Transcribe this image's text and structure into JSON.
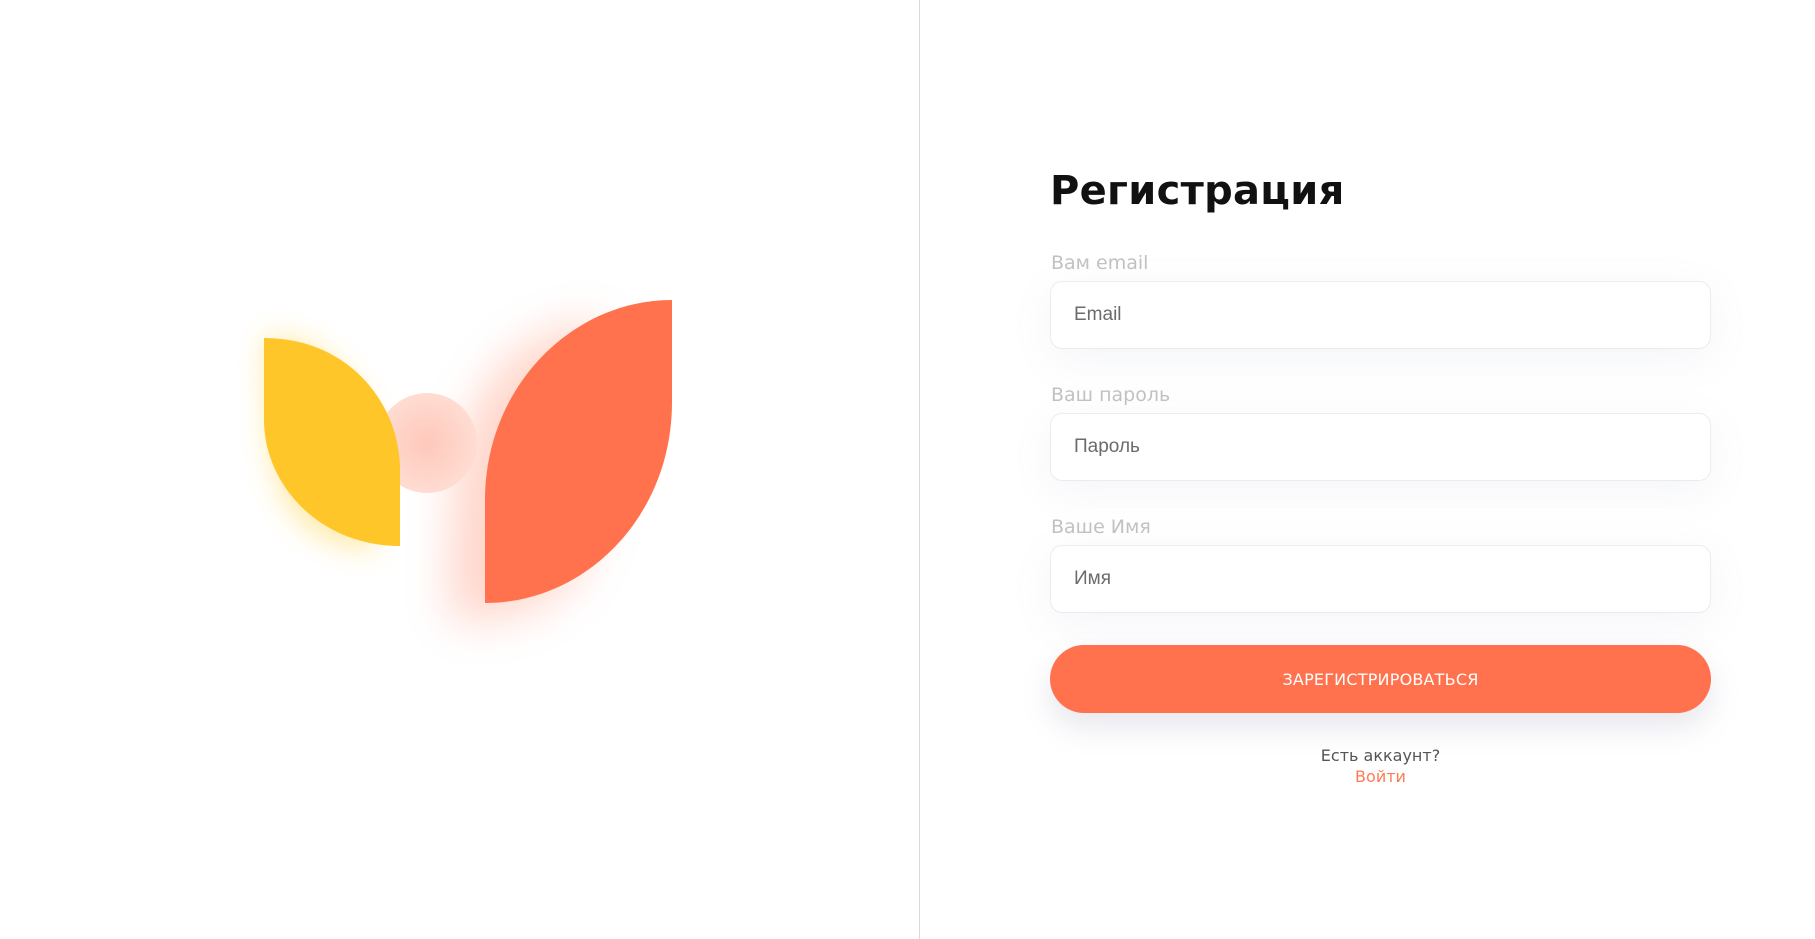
{
  "colors": {
    "accent": "#ff724d",
    "logo_yellow": "#ffc629",
    "logo_orange": "#ff724d",
    "logo_circle": "#ffd6cc",
    "label_gray": "#c2c2c2"
  },
  "form": {
    "title": "Регистрация",
    "fields": [
      {
        "label": "Вам email",
        "placeholder": "Email",
        "value": ""
      },
      {
        "label": "Ваш пароль",
        "placeholder": "Пароль",
        "value": ""
      },
      {
        "label": "Ваше Имя",
        "placeholder": "Имя",
        "value": ""
      }
    ],
    "submit_label": "ЗАРЕГИСТРИРОВАТЬСЯ",
    "account_question": "Есть аккаунт?",
    "login_link": "Войти"
  }
}
